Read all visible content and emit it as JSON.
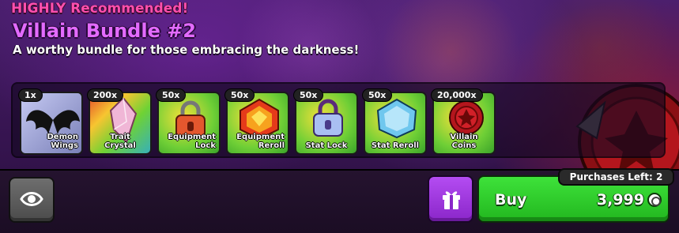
{
  "header": {
    "tag": "HIGHLY Recommended!",
    "title": "Villain Bundle #2",
    "subtitle": "A worthy bundle for those embracing the darkness!"
  },
  "rewards": [
    {
      "qty": "1x",
      "label": "Demon Wings",
      "icon": "demon-wings-icon",
      "bg": "#8d93c9"
    },
    {
      "qty": "200x",
      "label": "Trait Crystal",
      "icon": "trait-crystal-icon",
      "bg": "#7bd23a"
    },
    {
      "qty": "50x",
      "label": "Equipment Lock",
      "icon": "equipment-lock-icon",
      "bg": "#79d03a"
    },
    {
      "qty": "50x",
      "label": "Equipment Reroll",
      "icon": "equipment-reroll-icon",
      "bg": "#7bd23a"
    },
    {
      "qty": "50x",
      "label": "Stat Lock",
      "icon": "stat-lock-icon",
      "bg": "#79d03a"
    },
    {
      "qty": "50x",
      "label": "Stat Reroll",
      "icon": "stat-reroll-icon",
      "bg": "#7bd23a"
    },
    {
      "qty": "20,000x",
      "label": "Villain Coins",
      "icon": "villain-coin-icon",
      "bg": "#79d03a"
    }
  ],
  "actions": {
    "buy_label": "Buy",
    "price": "3,999",
    "purchases_left": "Purchases Left: 2"
  },
  "colors": {
    "accent_pink": "#ff4fae",
    "title_purple": "#e36bff",
    "buy_green": "#2fcb2b",
    "gift_purple": "#a23ee0"
  }
}
